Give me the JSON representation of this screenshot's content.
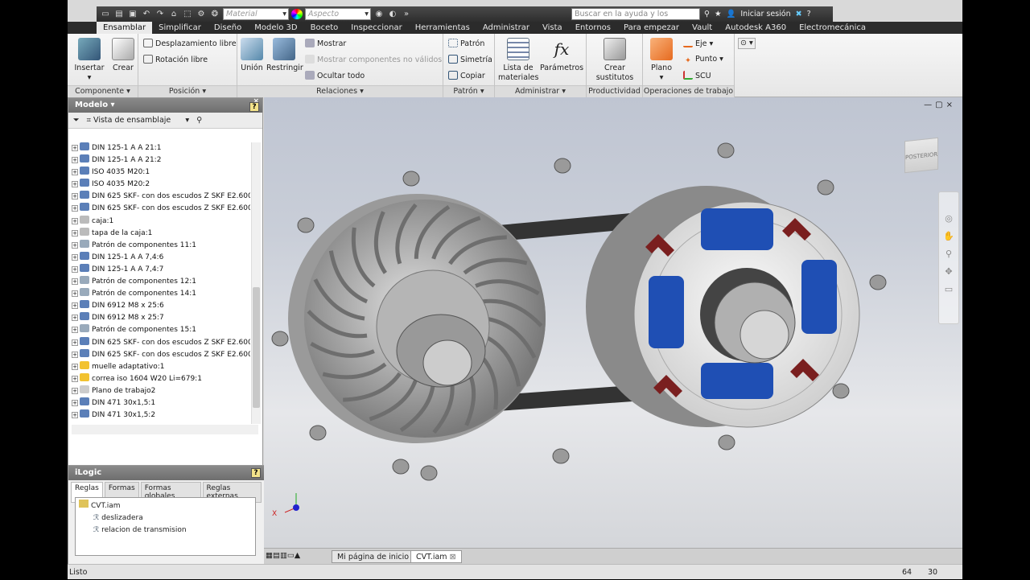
{
  "qat": {
    "material": "Material",
    "aspect": "Aspecto",
    "search_placeholder": "Buscar en la ayuda y los comanc",
    "signin": "Iniciar sesión"
  },
  "tabs": [
    "Ensamblar",
    "Simplificar",
    "Diseño",
    "Modelo 3D",
    "Boceto",
    "Inspeccionar",
    "Herramientas",
    "Administrar",
    "Vista",
    "Entornos",
    "Para empezar",
    "Vault",
    "Autodesk A360",
    "Electromecánica"
  ],
  "ribbon": {
    "componente": {
      "label": "Componente",
      "insert": "Insertar",
      "create": "Crear"
    },
    "posicion": {
      "label": "Posición",
      "free_move": "Desplazamiento libre",
      "free_rotate": "Rotación libre"
    },
    "relaciones": {
      "label": "Relaciones",
      "union": "Unión",
      "restrict": "Restringir",
      "show": "Mostrar",
      "show_no_valid": "Mostrar componentes no válidos",
      "hide_all": "Ocultar todo"
    },
    "patron": {
      "label": "Patrón",
      "pattern": "Patrón",
      "symmetry": "Simetría",
      "copy": "Copiar"
    },
    "administrar": {
      "label": "Administrar",
      "bom1": "Lista de",
      "bom2": "materiales",
      "params": "Parámetros"
    },
    "productividad": {
      "label": "Productividad",
      "sub1": "Crear",
      "sub2": "sustitutos"
    },
    "operaciones": {
      "label": "Operaciones de trabajo",
      "plane": "Plano",
      "axis": "Eje",
      "point": "Punto",
      "ucs": "SCU"
    }
  },
  "model": {
    "title": "Modelo",
    "view": "Vista de ensamblaje",
    "items": [
      "DIN 125-1 A A 21:1",
      "DIN 125-1 A A 21:2",
      "ISO 4035 M20:1",
      "ISO 4035 M20:2",
      "DIN 625 SKF- con dos escudos Z SKF E2.6006",
      "DIN 625 SKF- con dos escudos Z SKF E2.6006",
      "caja:1",
      "tapa de la caja:1",
      "Patrón de componentes 11:1",
      "DIN 125-1 A A 7,4:6",
      "DIN 125-1 A A 7,4:7",
      "Patrón de componentes 12:1",
      "Patrón de componentes 14:1",
      "DIN 6912 M8 x 25:6",
      "DIN 6912 M8 x 25:7",
      "Patrón de componentes 15:1",
      "DIN 625 SKF- con dos escudos Z SKF E2.6006",
      "DIN 625 SKF- con dos escudos Z SKF E2.6006",
      "muelle adaptativo:1",
      "correa iso 1604 W20 Li=679:1",
      "Plano de trabajo2",
      "DIN 471 30x1,5:1",
      "DIN 471 30x1,5:2"
    ]
  },
  "ilogic": {
    "title": "iLogic",
    "tabs": [
      "Reglas",
      "Formas",
      "Formas globales",
      "Reglas externas"
    ],
    "root": "CVT.iam",
    "rules": [
      "deslizadera",
      "relacion de transmision"
    ]
  },
  "viewcube_label": "POSTERIOR",
  "doc_tabs": [
    "Mi página de inicio",
    "CVT.iam"
  ],
  "status": {
    "text": "Listo",
    "n1": "64",
    "n2": "30"
  }
}
